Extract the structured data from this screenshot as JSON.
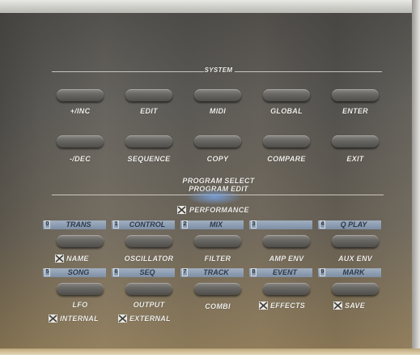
{
  "system": {
    "title": "SYSTEM",
    "row1": [
      "+/INC",
      "EDIT",
      "MIDI",
      "GLOBAL",
      "ENTER"
    ],
    "row2": [
      "-/DEC",
      "SEQUENCE",
      "COPY",
      "COMPARE",
      "EXIT"
    ]
  },
  "program": {
    "select": "PROGRAM SELECT",
    "edit": "PROGRAM EDIT",
    "performance": "PERFORMANCE"
  },
  "tabs1": [
    {
      "num": "0",
      "label": "TRANS"
    },
    {
      "num": "1",
      "label": "CONTROL"
    },
    {
      "num": "2",
      "label": "MIX"
    },
    {
      "num": "3",
      "label": ""
    },
    {
      "num": "4",
      "label": "Q PLAY"
    }
  ],
  "row3": [
    "NAME",
    "OSCILLATOR",
    "FILTER",
    "AMP ENV",
    "AUX ENV"
  ],
  "tabs2": [
    {
      "num": "5",
      "label": "SONG"
    },
    {
      "num": "6",
      "label": "SEQ"
    },
    {
      "num": "7",
      "label": "TRACK"
    },
    {
      "num": "8",
      "label": "EVENT"
    },
    {
      "num": "9",
      "label": "MARK"
    }
  ],
  "row4": [
    "LFO",
    "OUTPUT",
    "COMBI",
    "EFFECTS",
    "SAVE"
  ],
  "row5": [
    "INTERNAL",
    "EXTERNAL"
  ]
}
